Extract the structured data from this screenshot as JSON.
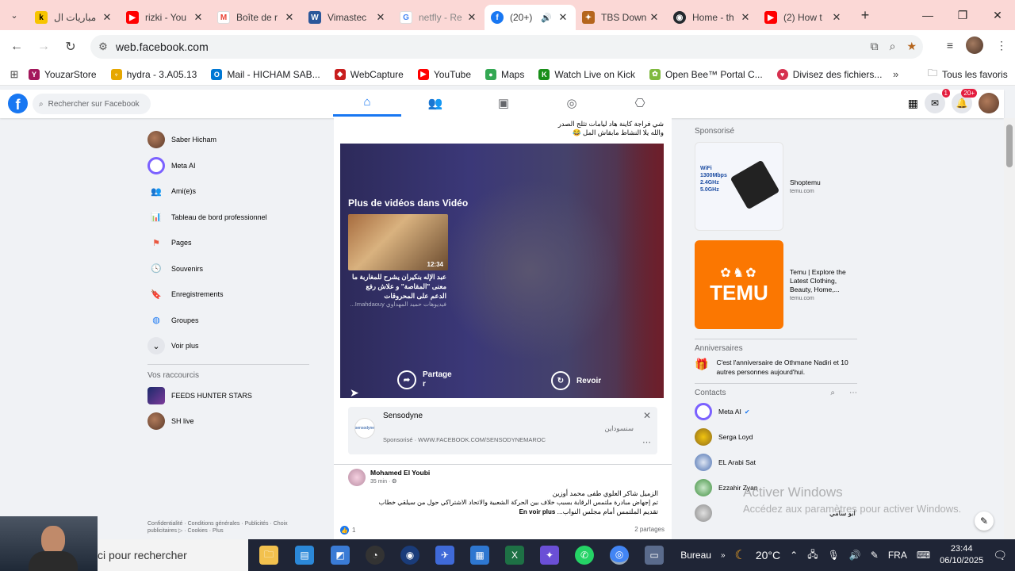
{
  "browser": {
    "tabs": [
      {
        "title": "مباريات ال",
        "fav_color": "#f7c400",
        "fav_text": "k"
      },
      {
        "title": "rizki - You",
        "fav_color": "#ff0000",
        "fav_text": "▶"
      },
      {
        "title": "Boîte de r",
        "fav_color": "#ffffff",
        "fav_text": "M"
      },
      {
        "title": "Vimastec",
        "fav_color": "#2b579a",
        "fav_text": "W"
      },
      {
        "title": "netfly - Re",
        "fav_color": "#ffffff",
        "fav_text": "G"
      },
      {
        "title": "(20+)",
        "fav_color": "#1877f2",
        "fav_text": "f",
        "active": true
      },
      {
        "title": "TBS Down",
        "fav_color": "#b5651d",
        "fav_text": "✦"
      },
      {
        "title": "Home - th",
        "fav_color": "#24292f",
        "fav_text": "◉"
      },
      {
        "title": "(2) How t",
        "fav_color": "#ff0000",
        "fav_text": "▶"
      }
    ],
    "url": "web.facebook.com",
    "bookmarks": [
      {
        "label": "YouzarStore",
        "color": "#a3185c"
      },
      {
        "label": "hydra - 3.A05.13",
        "color": "#e6a700"
      },
      {
        "label": "Mail - HICHAM SAB...",
        "color": "#0078d4"
      },
      {
        "label": "WebCapture",
        "color": "#c81d1d"
      },
      {
        "label": "YouTube",
        "color": "#ff0000"
      },
      {
        "label": "Maps",
        "color": "#34a853"
      },
      {
        "label": "Watch Live on Kick",
        "color": "#53fc18"
      },
      {
        "label": "Open Bee™ Portal C...",
        "color": "#7fb93f"
      },
      {
        "label": "Divisez des fichiers...",
        "color": "#d6304f"
      }
    ],
    "all_bookmarks": "Tous les favoris"
  },
  "fb": {
    "search_placeholder": "Rechercher sur Facebook",
    "messenger_badge": "1",
    "notif_badge": "20+",
    "left": {
      "items": [
        {
          "label": "Saber Hicham",
          "icon": "avatar"
        },
        {
          "label": "Meta AI",
          "icon": "meta-ai-icon"
        },
        {
          "label": "Ami(e)s",
          "icon": "friends-icon"
        },
        {
          "label": "Tableau de bord professionnel",
          "icon": "dashboard-icon"
        },
        {
          "label": "Pages",
          "icon": "flag-icon"
        },
        {
          "label": "Souvenirs",
          "icon": "clock-icon"
        },
        {
          "label": "Enregistrements",
          "icon": "bookmark-icon"
        },
        {
          "label": "Groupes",
          "icon": "groups-icon"
        },
        {
          "label": "Voir plus",
          "icon": "chevron-down-icon"
        }
      ],
      "shortcuts_title": "Vos raccourcis",
      "shortcuts": [
        {
          "label": "FEEDS HUNTER STARS"
        },
        {
          "label": "SH live"
        }
      ],
      "footer": "Confidentialité · Conditions générales · Publicités · Choix publicitaires ▷ · Cookies · Plus"
    },
    "feed": {
      "top_caption_1": "شي فراجة كاينة هاد ليامات تثلج الصدر",
      "top_caption_2": "والله يلا النشاط مابقاش المل 😂",
      "more_videos": "Plus de vidéos dans Vidéo",
      "thumb_duration": "12:34",
      "video_caption": "عبد الإله بنكيران يشرح للمغاربة ما معنى \"المقاصة\" و علاش رفع الدعم على المحروقات",
      "video_source": "فيديوهات حميد المهداوي Imahdaouy...",
      "share_label_1": "Partage",
      "share_label_2": "r",
      "replay_label": "Revoir",
      "ad": {
        "name": "Sensodyne",
        "arabic": "سنسوداين",
        "meta": "Sponsorisé · WWW.FACEBOOK.COM/SENSODYNEMAROC"
      },
      "post": {
        "author": "Mohamed El Youbi",
        "time": "35 min · ",
        "line1": "الزميل شاكر العلوي طفى محمد أوزين",
        "line2": "تم إجهاض مبادرة ملتمس الرقابة بسبب خلاف بين الحركة الشعبية والاتحاد الاشتراكي حول من سيلقي خطاب",
        "line3": "تقديم الملتمس أمام مجلس النواب...",
        "see_more": "En voir plus",
        "likes": "1",
        "shares": "2 partages"
      }
    },
    "right": {
      "sponsored_title": "Sponsorisé",
      "ads": [
        {
          "title": "Shoptemu",
          "domain": "temu.com",
          "img_text": "WiFi 1300Mbps 2.4GHz 5.0GHz"
        },
        {
          "title": "Temu | Explore the Latest Clothing, Beauty, Home,...",
          "domain": "temu.com",
          "img_text": "TEMU"
        }
      ],
      "birthdays_title": "Anniversaires",
      "birthday_text": "C'est l'anniversaire de Othmane Nadiri et 10 autres personnes aujourd'hui.",
      "contacts_title": "Contacts",
      "contacts": [
        {
          "name": "Meta AI",
          "verified": true
        },
        {
          "name": "Serga Loyd"
        },
        {
          "name": "EL Arabi Sat"
        },
        {
          "name": "Ezzahir Zyan"
        },
        {
          "name": "ابو سامي"
        }
      ]
    }
  },
  "windows": {
    "watermark_1": "Activer Windows",
    "watermark_2": "Accédez aux paramètres pour activer Windows.",
    "search_text": "ci pour rechercher",
    "desktop_label": "Bureau",
    "weather": "20°C",
    "lang": "FRA",
    "time": "23:44",
    "date": "06/10/2025"
  }
}
